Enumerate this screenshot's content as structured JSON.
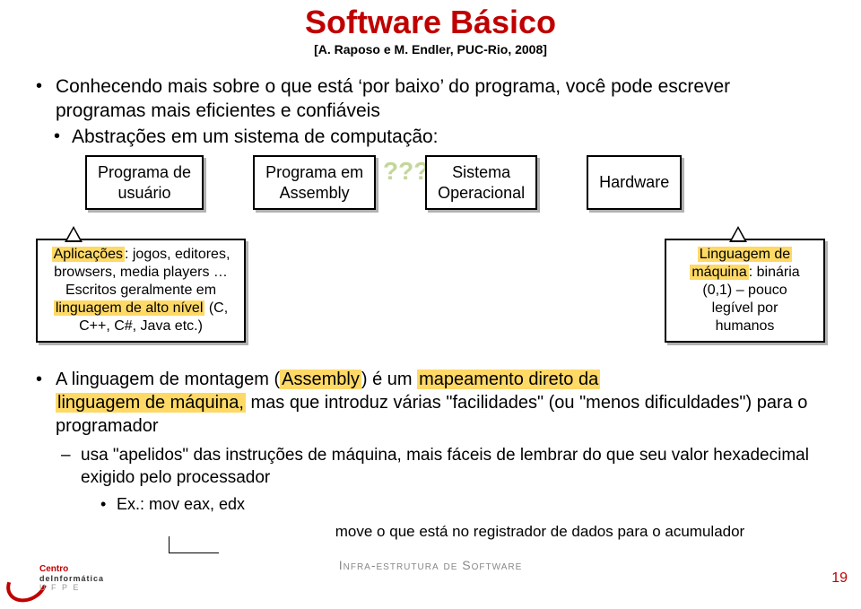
{
  "title": "Software Básico",
  "subtitle": "[A. Raposo e M. Endler, PUC-Rio, 2008]",
  "bullet1": "Conhecendo mais sobre o que está ‘por baixo’ do programa, você pode escrever programas mais eficientes e confiáveis",
  "bullet2": "Abstrações em um sistema de computação:",
  "boxes": {
    "b1_l1": "Programa de",
    "b1_l2": "usuário",
    "b2_l1": "Programa em",
    "b2_l2": "Assembly",
    "b3_l1": "Sistema",
    "b3_l2": "Operacional",
    "b4_l1": "Hardware"
  },
  "ghost": "???",
  "callout_left": {
    "l1_a": "Aplicações",
    "l1_b": ": jogos, editores,",
    "l2": "browsers, media players …",
    "l3": "Escritos geralmente em",
    "l4_a": "linguagem de alto nível",
    "l4_b": " (C,",
    "l5": "C++, C#, Java etc.)"
  },
  "callout_right": {
    "l1_a": "Linguagem de",
    "l2_a": "máquina",
    "l2_b": ": binária",
    "l3": "(0,1) – pouco",
    "l4": "legível por",
    "l5": "humanos"
  },
  "second": {
    "text_a": "A linguagem de montagem (",
    "text_b": "Assembly",
    "text_c": ") é um ",
    "hl1": "mapeamento direto da\n",
    "hl2": "linguagem de máquina,",
    "text_d": " mas que introduz várias \"facilidades\" (ou \"menos dificuldades\") para o programador"
  },
  "dash": "usa \"apelidos\" das instruções de máquina, mais fáceis de lembrar do que seu valor hexadecimal exigido pelo processador",
  "ex": "Ex.: mov eax, edx",
  "annotation": "move o que está no registrador de dados para o acumulador",
  "footer_label": "Infra-estrutura de Software",
  "page": "19",
  "logo": {
    "l1": "Centro",
    "l2": "deInformática",
    "l3": "U F P E"
  }
}
